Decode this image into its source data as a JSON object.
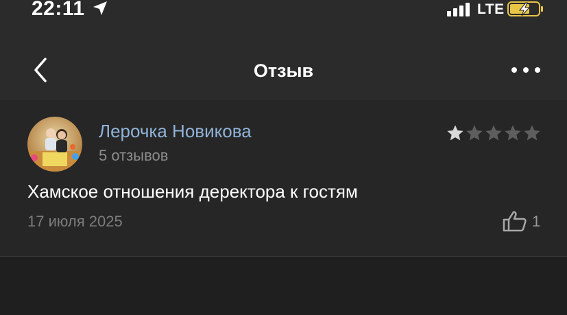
{
  "status_bar": {
    "time": "22:11",
    "network": "LTE",
    "icons": [
      "location-arrow-icon",
      "signal-bars-icon",
      "battery-charging-icon"
    ]
  },
  "nav": {
    "title": "Отзыв",
    "icons": [
      "back-chevron-icon",
      "more-dots-icon"
    ]
  },
  "review": {
    "author_name": "Лерочка Новикова",
    "author_reviews": "5 отзывов",
    "rating": 1,
    "rating_max": 5,
    "text": "Хамское отношения деректора к гостям",
    "date": "17 июля 2025",
    "likes": "1",
    "colors": {
      "author_name": "#8fb3d9",
      "star_filled": "#d9d9d9",
      "star_empty": "#5e5e5e"
    }
  }
}
